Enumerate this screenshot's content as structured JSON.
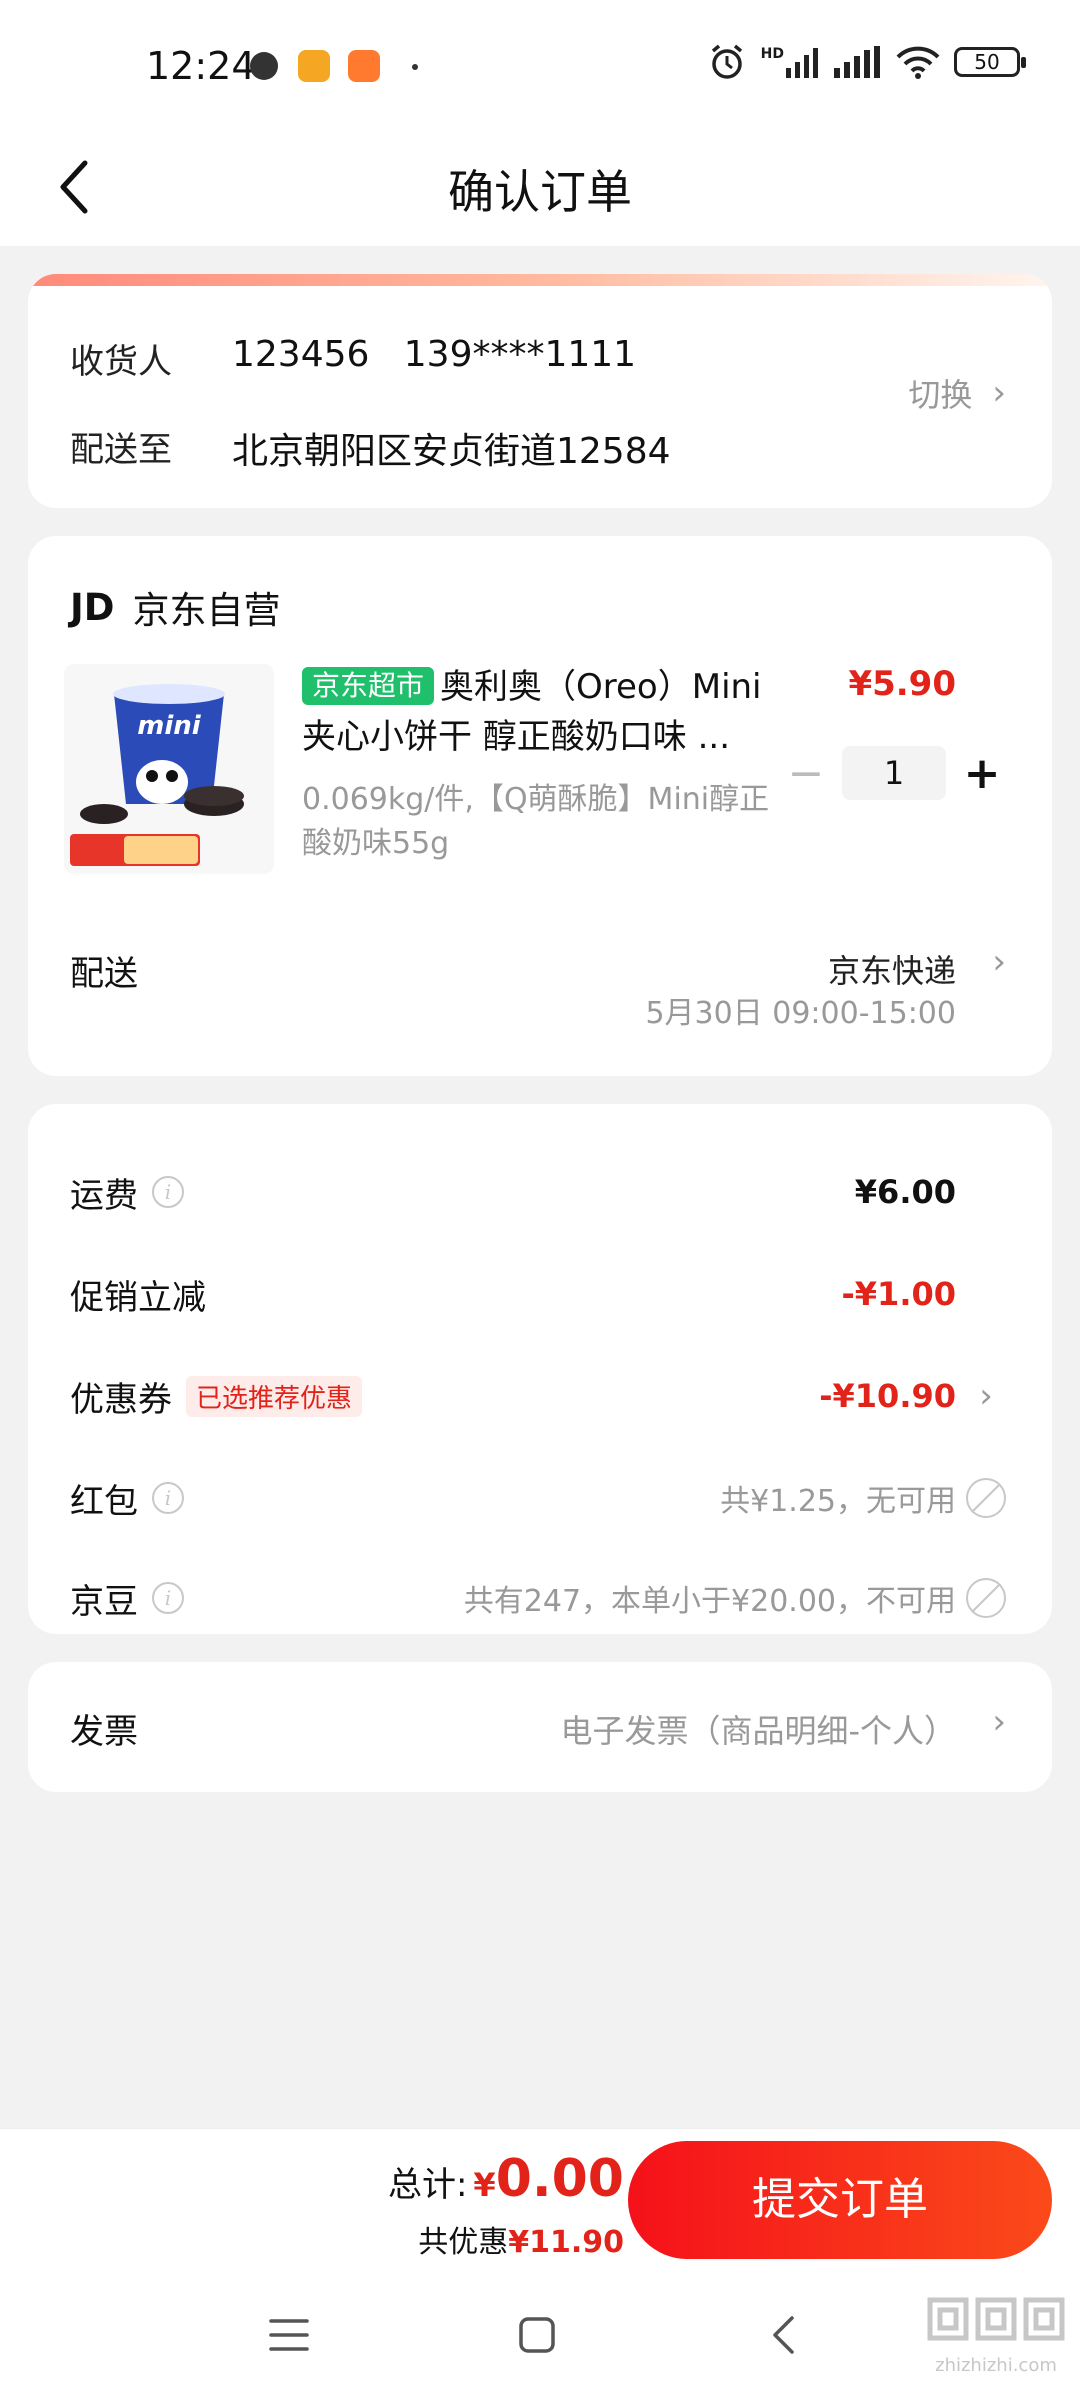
{
  "status_bar": {
    "time": "12:24",
    "battery": "50",
    "network": "HD"
  },
  "header": {
    "title": "确认订单"
  },
  "address": {
    "receiver_label": "收货人",
    "receiver_value": "123456   139****1111",
    "deliver_to_label": "配送至",
    "deliver_to_value": "北京朝阳区安贞街道12584",
    "switch_label": "切换"
  },
  "store": {
    "logo": "JD",
    "name": "京东自营"
  },
  "product": {
    "tag": "京东超市",
    "title": "奥利奥（Oreo）Mini夹心小饼干 醇正酸奶口味 ...",
    "spec": "0.069kg/件,【Q萌酥脆】Mini醇正酸奶味55g",
    "price": "¥5.90",
    "quantity": "1"
  },
  "delivery": {
    "label": "配送",
    "method": "京东快递",
    "time": "5月30日 09:00-15:00"
  },
  "fees": {
    "freight_label": "运费",
    "freight_value": "¥6.00",
    "promo_label": "促销立减",
    "promo_value": "-¥1.00",
    "coupon_label": "优惠券",
    "coupon_tag": "已选推荐优惠",
    "coupon_value": "-¥10.90",
    "redpacket_label": "红包",
    "redpacket_value": "共¥1.25，无可用",
    "jingdou_label": "京豆",
    "jingdou_value": "共有247，本单小于¥20.00，不可用"
  },
  "invoice": {
    "label": "发票",
    "value": "电子发票（商品明细-个人）"
  },
  "bottom": {
    "total_label": "总计:",
    "total_currency": "¥",
    "total_amount": "0.00",
    "discount_label": "共优惠",
    "discount_amount": "¥11.90",
    "submit_label": "提交订单"
  },
  "watermark": {
    "site": "zhizhizhi.com"
  },
  "colors": {
    "accent_red": "#e2231a",
    "tag_green": "#1fbf6b",
    "background": "#f2f2f2"
  }
}
